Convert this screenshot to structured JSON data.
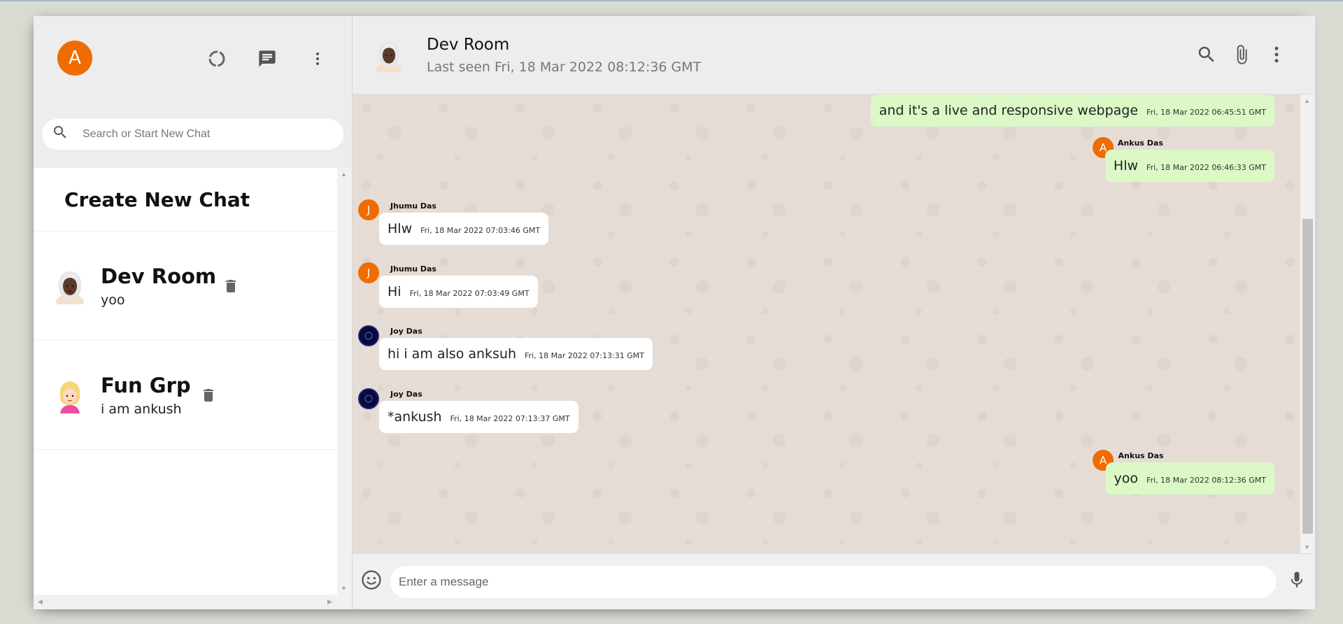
{
  "user": {
    "initial": "A"
  },
  "search": {
    "placeholder": "Search or Start New Chat"
  },
  "sidebar": {
    "create_label": "Create New Chat",
    "rooms": [
      {
        "name": "Dev Room",
        "last_message": "yoo"
      },
      {
        "name": "Fun Grp",
        "last_message": "i am ankush"
      }
    ]
  },
  "chat_header": {
    "title": "Dev Room",
    "subtitle": "Last seen Fri, 18 Mar 2022 08:12:36 GMT"
  },
  "messages": [
    {
      "author": "",
      "initial": "",
      "text": "and it's a live and responsive webpage",
      "time": "Fri, 18 Mar 2022 06:45:51 GMT",
      "mine": true
    },
    {
      "author": "Ankus Das",
      "initial": "A",
      "text": "Hlw",
      "time": "Fri, 18 Mar 2022 06:46:33 GMT",
      "mine": true
    },
    {
      "author": "Jhumu Das",
      "initial": "J",
      "text": "Hlw",
      "time": "Fri, 18 Mar 2022 07:03:46 GMT",
      "mine": false
    },
    {
      "author": "Jhumu Das",
      "initial": "J",
      "text": "Hi",
      "time": "Fri, 18 Mar 2022 07:03:49 GMT",
      "mine": false
    },
    {
      "author": "Joy Das",
      "initial": "",
      "text": "hi i am also anksuh",
      "time": "Fri, 18 Mar 2022 07:13:31 GMT",
      "mine": false
    },
    {
      "author": "Joy Das",
      "initial": "",
      "text": "*ankush",
      "time": "Fri, 18 Mar 2022 07:13:37 GMT",
      "mine": false
    },
    {
      "author": "Ankus Das",
      "initial": "A",
      "text": "yoo",
      "time": "Fri, 18 Mar 2022 08:12:36 GMT",
      "mine": true
    }
  ],
  "composer": {
    "placeholder": "Enter a message"
  },
  "colors": {
    "accent": "#ef6c00",
    "own_bubble": "#dcf8c6",
    "background": "#e5ddd5"
  }
}
